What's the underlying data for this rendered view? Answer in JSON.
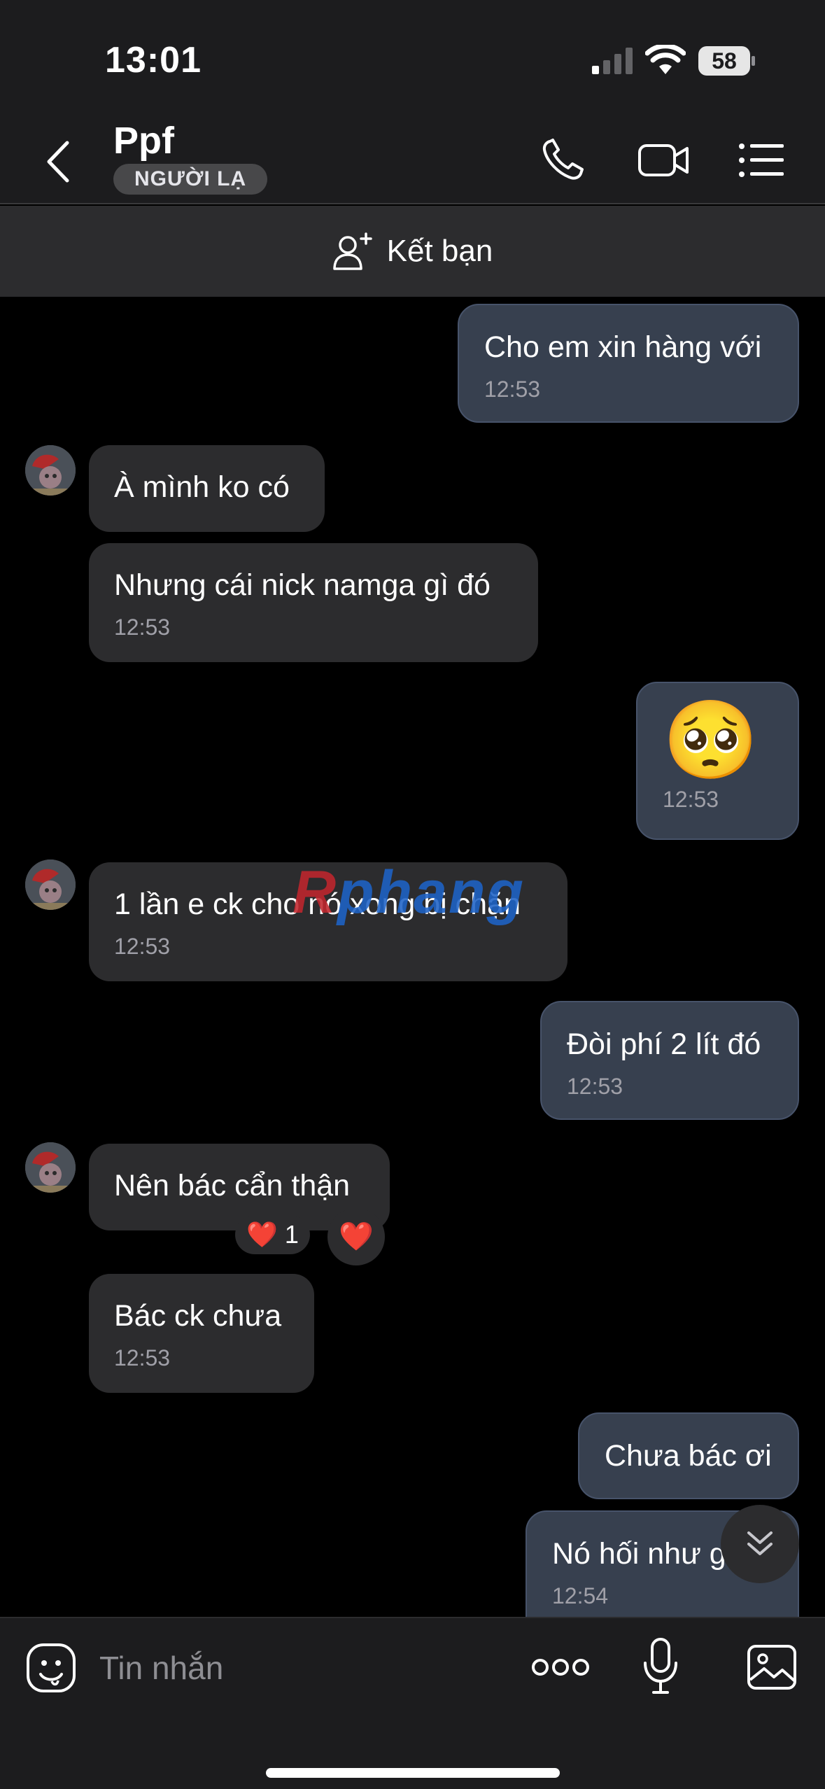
{
  "status_bar": {
    "time": "13:01",
    "battery": "58"
  },
  "header": {
    "contact_name": "Ppf",
    "contact_tag": "NGƯỜI LẠ",
    "icons": [
      "back-icon",
      "phone-icon",
      "video-icon",
      "menu-icon"
    ]
  },
  "add_friend": {
    "label": "Kết bạn",
    "icon": "add-person-icon"
  },
  "messages": [
    {
      "side": "mine",
      "text": "Cho em xin hàng với",
      "time": "12:53"
    },
    {
      "side": "theirs",
      "text": "À mình ko có",
      "time": ""
    },
    {
      "side": "theirs",
      "text": "Nhưng cái nick namga gì đó",
      "time": "12:53"
    },
    {
      "side": "mine",
      "text": "🥺",
      "time": "12:53"
    },
    {
      "side": "theirs",
      "text": "1 lần e ck cho nó xong bị chặn",
      "time": "12:53"
    },
    {
      "side": "mine",
      "text": "Đòi phí 2 lít đó",
      "time": "12:53"
    },
    {
      "side": "theirs",
      "text": "Nên bác cẩn thận",
      "time": "",
      "reaction": {
        "emoji": "❤️",
        "count": "1"
      }
    },
    {
      "side": "theirs",
      "text": "Bác ck chưa",
      "time": "12:53"
    },
    {
      "side": "mine",
      "text": "Chưa bác ơi",
      "time": ""
    },
    {
      "side": "mine",
      "text": "Nó hối như g",
      "time": "12:54"
    }
  ],
  "watermark": {
    "part1": "R",
    "part2": "phang"
  },
  "composer": {
    "placeholder": "Tin nhắn",
    "icons": [
      "sticker-icon",
      "more-icon",
      "microphone-icon",
      "image-icon"
    ]
  },
  "colors": {
    "background": "#000000",
    "bar": "#1c1c1e",
    "my_bubble": "#37404f",
    "their_bubble": "#2c2c2e",
    "timestamp": "#a0a0a8"
  }
}
